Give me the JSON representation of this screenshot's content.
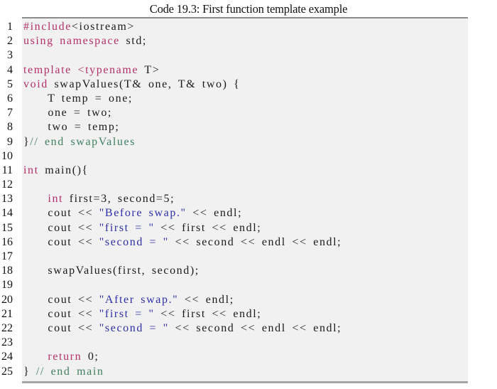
{
  "caption": "Code 19.3: First function template example",
  "colors": {
    "keyword": "#b5306b",
    "string": "#2d2fa8",
    "comment": "#3f7f5f",
    "text": "#1a1a1a",
    "background": "#f1f1f1"
  },
  "lines": [
    {
      "n": "1",
      "tokens": [
        {
          "t": "pp",
          "v": "#include"
        },
        {
          "t": "plain",
          "v": "<iostream>"
        }
      ]
    },
    {
      "n": "2",
      "tokens": [
        {
          "t": "kw",
          "v": "using namespace"
        },
        {
          "t": "plain",
          "v": " std;"
        }
      ]
    },
    {
      "n": "3",
      "tokens": []
    },
    {
      "n": "4",
      "tokens": [
        {
          "t": "kw",
          "v": "template <typename"
        },
        {
          "t": "plain",
          "v": " T>"
        }
      ]
    },
    {
      "n": "5",
      "tokens": [
        {
          "t": "kw",
          "v": "void"
        },
        {
          "t": "plain",
          "v": " swapValues(T& one, T& two) {"
        }
      ]
    },
    {
      "n": "6",
      "tokens": [
        {
          "t": "plain",
          "v": "    T temp = one;"
        }
      ]
    },
    {
      "n": "7",
      "tokens": [
        {
          "t": "plain",
          "v": "    one = two;"
        }
      ]
    },
    {
      "n": "8",
      "tokens": [
        {
          "t": "plain",
          "v": "    two = temp;"
        }
      ]
    },
    {
      "n": "9",
      "tokens": [
        {
          "t": "plain",
          "v": "}"
        },
        {
          "t": "cm",
          "v": "// end swapValues"
        }
      ]
    },
    {
      "n": "10",
      "tokens": []
    },
    {
      "n": "11",
      "tokens": [
        {
          "t": "kw",
          "v": "int"
        },
        {
          "t": "plain",
          "v": " main(){"
        }
      ]
    },
    {
      "n": "12",
      "tokens": []
    },
    {
      "n": "13",
      "tokens": [
        {
          "t": "plain",
          "v": "    "
        },
        {
          "t": "kw",
          "v": "int"
        },
        {
          "t": "plain",
          "v": " first=3, second=5;"
        }
      ]
    },
    {
      "n": "14",
      "tokens": [
        {
          "t": "plain",
          "v": "    cout << "
        },
        {
          "t": "str",
          "v": "\"Before swap.\""
        },
        {
          "t": "plain",
          "v": " << endl;"
        }
      ]
    },
    {
      "n": "15",
      "tokens": [
        {
          "t": "plain",
          "v": "    cout << "
        },
        {
          "t": "str",
          "v": "\"first = \""
        },
        {
          "t": "plain",
          "v": " << first << endl;"
        }
      ]
    },
    {
      "n": "16",
      "tokens": [
        {
          "t": "plain",
          "v": "    cout << "
        },
        {
          "t": "str",
          "v": "\"second = \""
        },
        {
          "t": "plain",
          "v": " << second << endl << endl;"
        }
      ]
    },
    {
      "n": "17",
      "tokens": []
    },
    {
      "n": "18",
      "tokens": [
        {
          "t": "plain",
          "v": "    swapValues(first, second);"
        }
      ]
    },
    {
      "n": "19",
      "tokens": []
    },
    {
      "n": "20",
      "tokens": [
        {
          "t": "plain",
          "v": "    cout << "
        },
        {
          "t": "str",
          "v": "\"After swap.\""
        },
        {
          "t": "plain",
          "v": " << endl;"
        }
      ]
    },
    {
      "n": "21",
      "tokens": [
        {
          "t": "plain",
          "v": "    cout << "
        },
        {
          "t": "str",
          "v": "\"first = \""
        },
        {
          "t": "plain",
          "v": " << first << endl;"
        }
      ]
    },
    {
      "n": "22",
      "tokens": [
        {
          "t": "plain",
          "v": "    cout << "
        },
        {
          "t": "str",
          "v": "\"second = \""
        },
        {
          "t": "plain",
          "v": " << second << endl << endl;"
        }
      ]
    },
    {
      "n": "23",
      "tokens": []
    },
    {
      "n": "24",
      "tokens": [
        {
          "t": "plain",
          "v": "    "
        },
        {
          "t": "kw",
          "v": "return"
        },
        {
          "t": "plain",
          "v": " 0;"
        }
      ]
    },
    {
      "n": "25",
      "tokens": [
        {
          "t": "plain",
          "v": "} "
        },
        {
          "t": "cm",
          "v": "// end main"
        }
      ]
    }
  ]
}
